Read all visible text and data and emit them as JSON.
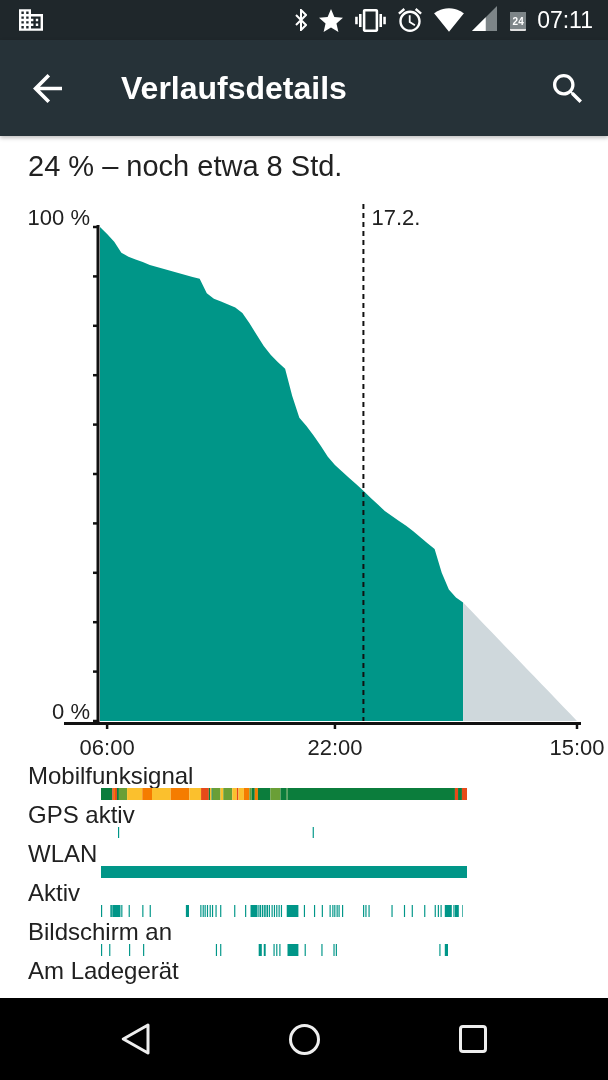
{
  "status_bar": {
    "battery_text": "24",
    "time": "07:11"
  },
  "app_bar": {
    "title": "Verlaufsdetails"
  },
  "summary": "24 % – noch etwa 8 Std.",
  "chart_data": {
    "type": "area",
    "categories": [
      null,
      "06:00",
      null,
      null,
      null,
      null,
      null,
      null,
      null,
      null,
      null,
      null,
      null,
      null,
      null,
      null,
      null,
      null,
      null,
      null,
      null,
      null,
      null,
      null,
      null,
      null,
      null,
      null,
      null,
      null,
      null,
      null,
      null,
      "22:00",
      null,
      null,
      null,
      null,
      null,
      null,
      null,
      null,
      null,
      null,
      null,
      null,
      null,
      null,
      null,
      null,
      null,
      null,
      null,
      null,
      null,
      null,
      null,
      null,
      null,
      null,
      null,
      null,
      null,
      null,
      null,
      null,
      null,
      "15:00"
    ],
    "series": [
      {
        "color": "#009688",
        "values": [
          100,
          98.6,
          97.0,
          94.8,
          94.0,
          93.4,
          92.9,
          92.3,
          91.9,
          91.5,
          91.1,
          90.7,
          90.3,
          89.9,
          89.5,
          86.6,
          85.5,
          84.9,
          84.3,
          83.7,
          82.6,
          80.5,
          78.2,
          75.9,
          74.1,
          72.6,
          71.3,
          65.8,
          61.4,
          59.7,
          57.8,
          55.7,
          53.5,
          51.8,
          50.5,
          49.2,
          47.9,
          46.6,
          45.2,
          43.9,
          42.5,
          41.5,
          40.5,
          39.5,
          38.4,
          37.2,
          36.0,
          34.8,
          30.0,
          26.6,
          25.0,
          24,
          null,
          null,
          null,
          null,
          null,
          null,
          null,
          null,
          null,
          null,
          null,
          null,
          null,
          null,
          null,
          null
        ]
      },
      {
        "color": "#cfd8dc",
        "values": [
          null,
          null,
          null,
          null,
          null,
          null,
          null,
          null,
          null,
          null,
          null,
          null,
          null,
          null,
          null,
          null,
          null,
          null,
          null,
          null,
          null,
          null,
          null,
          null,
          null,
          null,
          null,
          null,
          null,
          null,
          null,
          null,
          null,
          null,
          null,
          null,
          null,
          null,
          null,
          null,
          null,
          null,
          null,
          null,
          null,
          null,
          null,
          null,
          null,
          null,
          null,
          24,
          22.5,
          21,
          19.5,
          18,
          16.5,
          15,
          13.5,
          12,
          10.5,
          9,
          7.5,
          6,
          4.5,
          3,
          1.5,
          0
        ]
      }
    ],
    "ylim": [
      0,
      100
    ],
    "yticks": [
      {
        "value": 0,
        "label": "0 %"
      },
      {
        "value": 100,
        "label": "100 %"
      }
    ]
  },
  "day_change_label": "17.2.",
  "timelines": [
    {
      "label": "Mobilfunksignal",
      "kind": "signal"
    },
    {
      "label": "GPS aktiv",
      "kind": "gps"
    },
    {
      "label": "WLAN",
      "kind": "wifi"
    },
    {
      "label": "Aktiv",
      "kind": "awake"
    },
    {
      "label": "Bildschirm an",
      "kind": "screen"
    },
    {
      "label": "Am Ladegerät",
      "kind": "charging"
    }
  ]
}
